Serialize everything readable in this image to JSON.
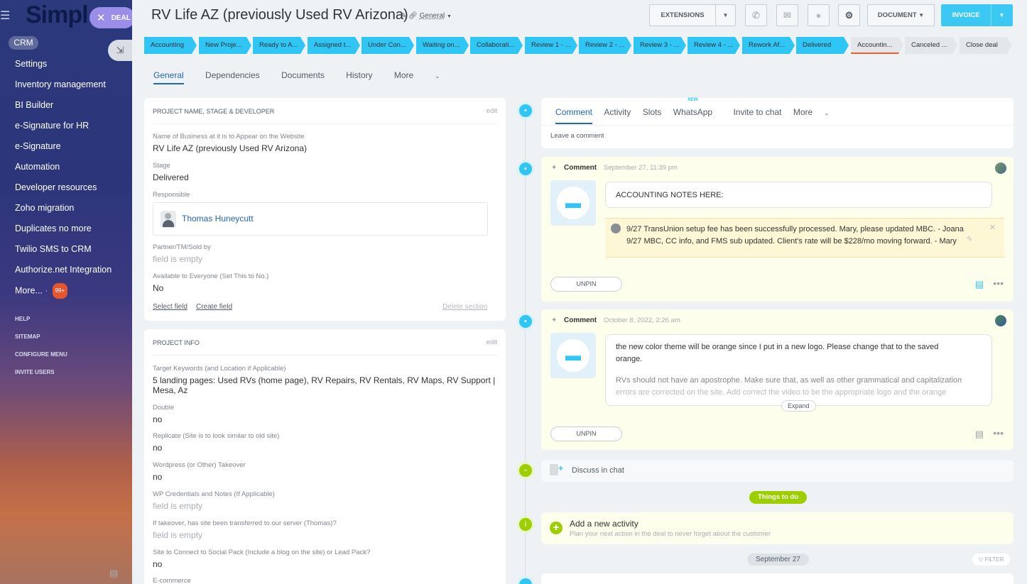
{
  "sidebar": {
    "logo": "Simpl",
    "badge_label": "DEAL",
    "crm_label": "CRM",
    "items": [
      {
        "label": "Settings"
      },
      {
        "label": "Inventory management"
      },
      {
        "label": "BI Builder"
      },
      {
        "label": "e-Signature for HR"
      },
      {
        "label": "e-Signature"
      },
      {
        "label": "Automation"
      },
      {
        "label": "Developer resources"
      },
      {
        "label": "Zoho migration"
      },
      {
        "label": "Duplicates no more"
      },
      {
        "label": "Twilio SMS to CRM"
      },
      {
        "label": "Authorize.net Integration"
      }
    ],
    "more_label": "More...",
    "more_count": "99+",
    "small_items": [
      {
        "label": "HELP"
      },
      {
        "label": "SITEMAP"
      },
      {
        "label": "CONFIGURE MENU"
      },
      {
        "label": "INVITE USERS"
      }
    ]
  },
  "header": {
    "title": "RV Life AZ (previously Used RV Arizona)",
    "category": "General",
    "extensions_label": "EXTENSIONS",
    "document_label": "DOCUMENT",
    "invoice_label": "INVOICE"
  },
  "stages": [
    {
      "label": "Accounting"
    },
    {
      "label": "New Proje..."
    },
    {
      "label": "Ready to A..."
    },
    {
      "label": "Assigned t..."
    },
    {
      "label": "Under Con..."
    },
    {
      "label": "Waiting on..."
    },
    {
      "label": "Collaborati..."
    },
    {
      "label": "Review 1 - ..."
    },
    {
      "label": "Review 2 - ..."
    },
    {
      "label": "Review 3 - ..."
    },
    {
      "label": "Review 4 - ..."
    },
    {
      "label": "Rework Af..."
    },
    {
      "label": "Delivered"
    },
    {
      "label": "Accountin..."
    },
    {
      "label": "Canceled ..."
    },
    {
      "label": "Close deal"
    }
  ],
  "tabs": [
    {
      "label": "General"
    },
    {
      "label": "Dependencies"
    },
    {
      "label": "Documents"
    },
    {
      "label": "History"
    },
    {
      "label": "More"
    }
  ],
  "section1": {
    "title": "PROJECT NAME, STAGE & DEVELOPER",
    "edit": "edit",
    "fields": [
      {
        "label": "Name of Business at it is to Appear on the Website",
        "value": "RV Life AZ (previously Used RV Arizona)"
      },
      {
        "label": "Stage",
        "value": "Delivered"
      },
      {
        "label": "Responsible",
        "value": "Thomas Huneycutt"
      },
      {
        "label": "Partner/TM/Sold by",
        "value": "field is empty"
      },
      {
        "label": "Available to Everyone (Set This to No.)",
        "value": "No"
      }
    ],
    "select_field": "Select field",
    "create_field": "Create field",
    "delete_section": "Delete section"
  },
  "section2": {
    "title": "PROJECT INFO",
    "edit": "edit",
    "fields": [
      {
        "label": "Target Keywords (and Location if Applicable)",
        "value": "5 landing pages: Used RVs (home page), RV Repairs, RV Rentals, RV Maps, RV Support |",
        "value2": "Mesa, Az"
      },
      {
        "label": "Double",
        "value": "no"
      },
      {
        "label": "Replicate (Site is to look similar to old site)",
        "value": "no"
      },
      {
        "label": "Wordpress (or Other) Takeover",
        "value": "no"
      },
      {
        "label": "WP Credentials and Notes (If Applicable)",
        "value": "field is empty"
      },
      {
        "label": "If takeover, has site been transferred to our server (Thomas)?",
        "value": "field is empty"
      },
      {
        "label": "Site to Connect to Social Pack (Include a blog on the site) or Lead Pack?",
        "value": "no"
      },
      {
        "label": "E-commerce",
        "value": ""
      }
    ]
  },
  "editor": {
    "tabs": [
      {
        "label": "Comment"
      },
      {
        "label": "Activity"
      },
      {
        "label": "Slots"
      },
      {
        "label": "WhatsApp"
      },
      {
        "label": "Invite to chat"
      },
      {
        "label": "More"
      }
    ],
    "new_tag": "NEW",
    "placeholder": "Leave a comment"
  },
  "comments": [
    {
      "type": "Comment",
      "date": "September 27, 11:39 pm",
      "text": "ACCOUNTING NOTES HERE:",
      "note_line1": "9/27 TransUnion setup fee has been successfully processed. Mary, please updated MBC. - Joana",
      "note_line2": "9/27 MBC, CC info, and FMS sub updated. Client's rate will be $228/mo moving forward. - Mary",
      "unpin": "UNPIN"
    },
    {
      "type": "Comment",
      "date": "October 8, 2022, 2:26 am",
      "text1": "the new color theme will be orange since I put in a new logo. Please change that to the saved",
      "text2": "orange.",
      "text3": "RVs should not have an apostrophe. Make sure that, as well as other grammatical and capitalization",
      "text4": "errors are corrected on the site. Add correct the video to be the appropriate logo and the orange",
      "expand": "Expand",
      "unpin": "UNPIN"
    }
  ],
  "timeline": {
    "discuss": "Discuss in chat",
    "things_to_do": "Things to do",
    "add_activity": "Add a new activity",
    "add_activity_sub": "Plan your next action in the deal to never forget about the customer",
    "date_sep": "September 27",
    "filter": "FILTER"
  }
}
